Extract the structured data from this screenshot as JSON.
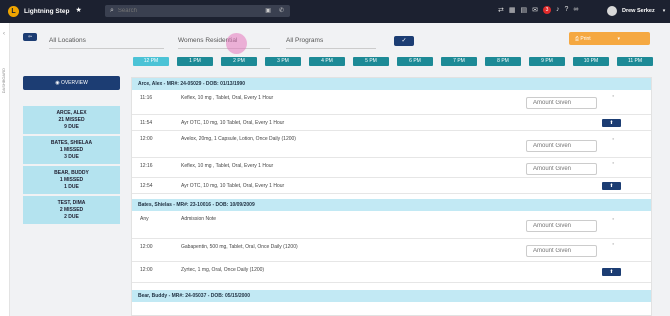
{
  "app": {
    "brand": "Lightning Step",
    "logo_letter": "L"
  },
  "search": {
    "placeholder": "Search"
  },
  "topbar": {
    "notification_count": "3",
    "user_name": "Drew Serkez"
  },
  "side_rail": {
    "label": "DASHBOARD"
  },
  "filters": {
    "location": "All Locations",
    "program_type": "Womens Residential",
    "programs": "All Programs"
  },
  "print_label": "Print",
  "times": [
    "12 PM",
    "1 PM",
    "2 PM",
    "3 PM",
    "4 PM",
    "5 PM",
    "6 PM",
    "7 PM",
    "8 PM",
    "9 PM",
    "10 PM",
    "11 PM"
  ],
  "overview_label": "OVERVIEW",
  "patients": [
    {
      "name": "ARCE, ALEX",
      "missed": "21 MISSED",
      "due": "9 DUE"
    },
    {
      "name": "BATES, SHIELAA",
      "missed": "1 MISSED",
      "due": "3 DUE"
    },
    {
      "name": "BEAR, BUDDY",
      "missed": "1 MISSED",
      "due": "1 DUE"
    },
    {
      "name": "TEST, DIMA",
      "missed": "2 MISSED",
      "due": "2 DUE"
    }
  ],
  "amount_placeholder": "Amount Given",
  "groups": [
    {
      "header": "Arce, Alex  -  MR#: 24-05029  -  DOB: 01/13/1990",
      "meds": [
        {
          "time": "11:16",
          "desc": "Keflex, 10 mg , Tablet, Oral, Every 1 Hour"
        },
        {
          "time": "11:54",
          "desc": "Ayr OTC, 10 mg, 10 Tablet, Oral, Every 1 Hour"
        },
        {
          "time": "12:00",
          "desc": "Avelox, 20mg, 1 Capsule, Lotion, Once Daily (1200)"
        },
        {
          "time": "12:16",
          "desc": "Keflex, 10 mg , Tablet, Oral, Every 1 Hour"
        },
        {
          "time": "12:54",
          "desc": "Ayr OTC, 10 mg, 10 Tablet, Oral, Every 1 Hour"
        }
      ]
    },
    {
      "header": "Bates, Shielas  -  MR#: 23-10016  -  DOB: 10/09/2009",
      "meds": [
        {
          "time": "Any",
          "desc": "Admission Note"
        },
        {
          "time": "12:00",
          "desc": "Gabapentin, 500 mg, Tablet, Oral, Once Daily (1200)"
        },
        {
          "time": "12:00",
          "desc": "Zyrtec, 1 mg, Oral, Once Daily (1200)"
        }
      ]
    },
    {
      "header": "Bear, Buddy  -  MR#: 24-05037  -  DOB: 05/15/2000",
      "meds": []
    }
  ]
}
